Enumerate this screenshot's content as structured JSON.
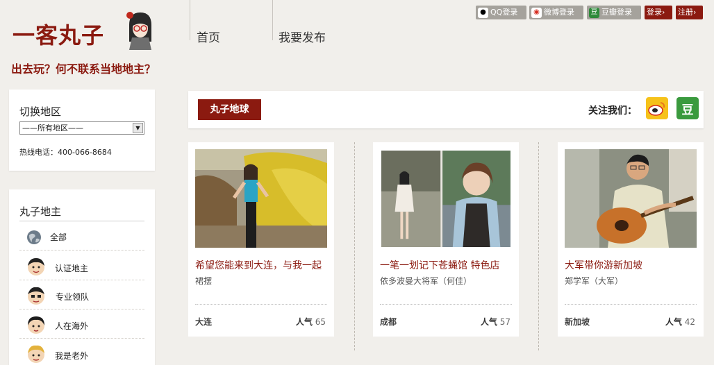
{
  "header": {
    "logo": "一客丸子",
    "slogan": "出去玩？何不联系当地地主？",
    "nav": [
      "首页",
      "我要发布"
    ],
    "auth": {
      "qq": "QQ登录",
      "weibo": "微博登录",
      "douban": "豆瓣登录",
      "login": "登录›",
      "register": "注册›"
    }
  },
  "sidebar": {
    "region_title": "切换地区",
    "region_select": "——所有地区——",
    "hotline": "热线电话：400-066-8684",
    "host_title": "丸子地主",
    "hosts": [
      {
        "label": "全部",
        "icon": "globe-icon"
      },
      {
        "label": "认证地主",
        "icon": "certified-avatar-icon"
      },
      {
        "label": "专业领队",
        "icon": "guide-avatar-icon"
      },
      {
        "label": "人在海外",
        "icon": "overseas-avatar-icon"
      },
      {
        "label": "我是老外",
        "icon": "foreigner-avatar-icon"
      }
    ]
  },
  "main": {
    "section": "丸子地球",
    "follow": "关注我们：",
    "douban_glyph": "豆",
    "popularity_label": "人气",
    "cards": [
      {
        "title": "希望您能来到大连，与我一起",
        "author": "裙摆",
        "city": "大连",
        "popularity": "65"
      },
      {
        "title": "一笔一划记下苍蝇馆 特色店",
        "author": "依多波曼大将军（何佳）",
        "city": "成都",
        "popularity": "57"
      },
      {
        "title": "大军带你游新加坡",
        "author": "郑学军（大军）",
        "city": "新加坡",
        "popularity": "42"
      }
    ]
  },
  "colors": {
    "accent": "#8b1a10",
    "background": "#f1efeb"
  }
}
